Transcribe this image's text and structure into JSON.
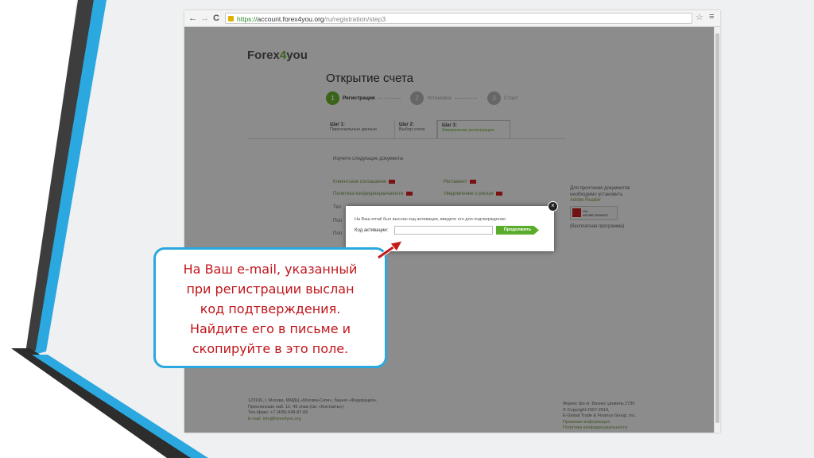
{
  "browser": {
    "url_scheme": "https://",
    "url_host": "account.forex4you.org",
    "url_path": "/ru/registration/step3",
    "back_icon": "←",
    "forward_icon": "→",
    "reload_icon": "C",
    "star_icon": "☆",
    "menu_icon": "≡"
  },
  "page": {
    "logo_prefix": "Forex",
    "logo_four": "4",
    "logo_suffix": "you",
    "title": "Открытие счета",
    "steps": [
      {
        "num": "1",
        "label": "Регистрация"
      },
      {
        "num": "2",
        "label": "Установка"
      },
      {
        "num": "3",
        "label": "Старт"
      }
    ],
    "tabs": [
      {
        "title": "Шаг 1:",
        "sub": "Персональные данные"
      },
      {
        "title": "Шаг 2:",
        "sub": "Выбор счета"
      },
      {
        "title": "Шаг 3:",
        "sub": "Завершение регистрации"
      }
    ],
    "study_heading": "Изучите следующие документы",
    "docs_left": [
      "Клиентское соглашение",
      "Политика конфиденциальности"
    ],
    "docs_right": [
      "Регламент",
      "Уведомление о рисках"
    ],
    "docs_truncated": [
      "Тел",
      "Пол",
      "Пол"
    ],
    "side_note_line1": "Для прочтения документов",
    "side_note_line2": "необходимо установить",
    "side_note_link": "Adobe Reader",
    "adobe_line1": "Get",
    "adobe_line2": "ADOBE READER",
    "free_note": "(бесплатная программа)",
    "footer_left": [
      "123100, г. Москва, ММДЦ «Москва-Сити», башня «Федерация»,",
      "Пресненская наб. 12, 45 этаж (см. «Контакты»)",
      "Тел./факс: +7 (495) 648-87-06",
      "E-mail: info@forex4you.org"
    ],
    "footer_right": [
      "Форекс фо ю. Бизнес уровень  2735",
      "© Copyright 2007-2014,",
      "E-Global Trade & Finance Group, Inc.",
      "Правовая информация",
      "Политика конфиденциальности"
    ]
  },
  "dialog": {
    "message": "На Ваш email был выслан код активации, введите его для подтверждения",
    "label": "Код активации:",
    "input_value": "",
    "submit_label": "Продолжить",
    "close_icon": "×"
  },
  "callout": {
    "text": "На Ваш e-mail, указанный\nпри регистрации выслан\nкод подтверждения.\nНайдите его в письме и\nскопируйте в это поле."
  },
  "colors": {
    "brand_green": "#6ab62d",
    "callout_border": "#2ba8df",
    "callout_text": "#c0151b",
    "arrow": "#c41a1a"
  }
}
